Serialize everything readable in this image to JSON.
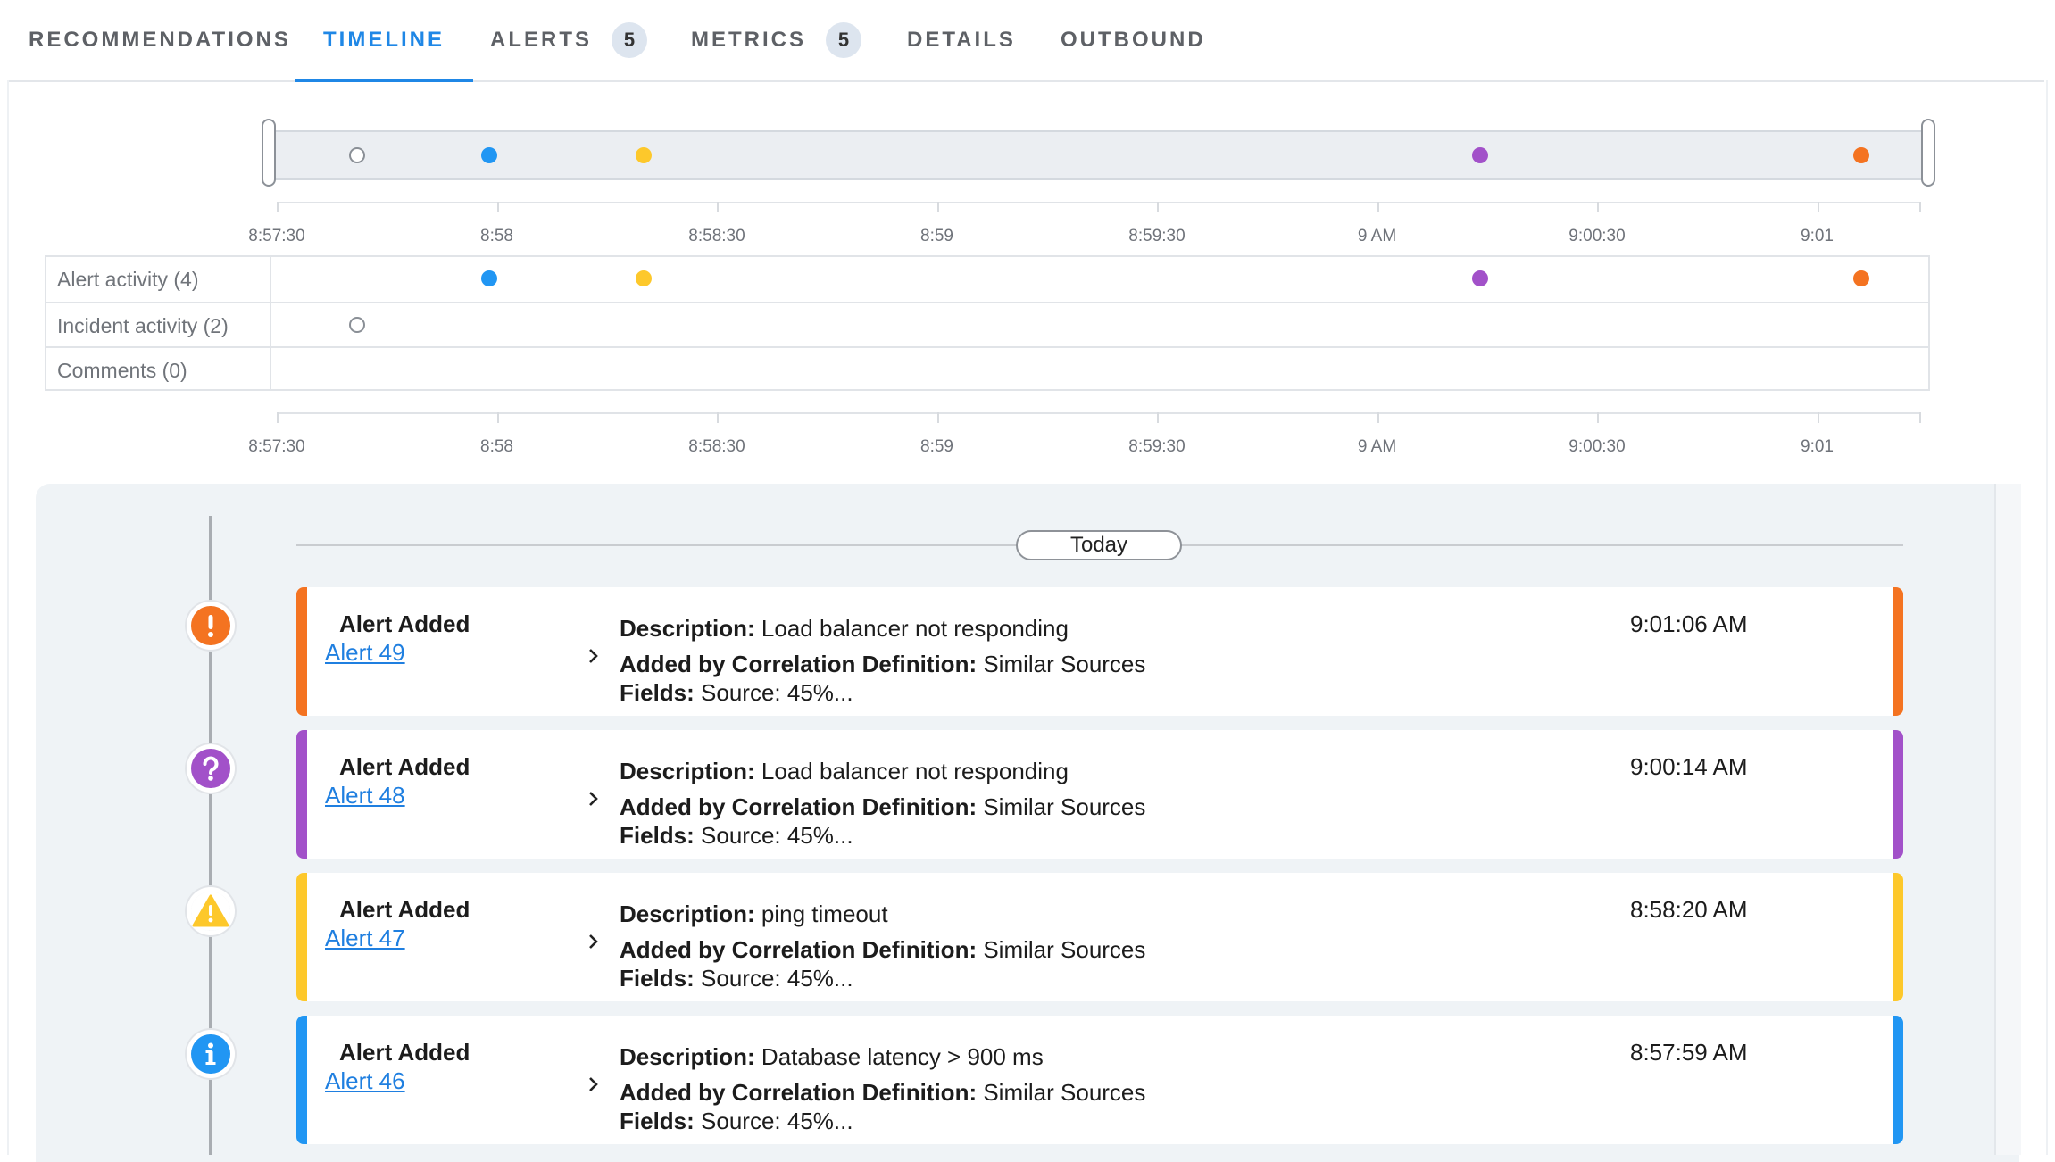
{
  "tabs": [
    {
      "label": "RECOMMENDATIONS",
      "active": false
    },
    {
      "label": "TIMELINE",
      "active": true
    },
    {
      "label": "ALERTS",
      "count": "5",
      "active": false
    },
    {
      "label": "METRICS",
      "count": "5",
      "active": false
    },
    {
      "label": "DETAILS",
      "active": false
    },
    {
      "label": "OUTBOUND",
      "active": false
    }
  ],
  "axis_ticks": [
    "8:57:30",
    "8:58",
    "8:58:30",
    "8:59",
    "8:59:30",
    "9 AM",
    "9:00:30",
    "9:01"
  ],
  "activity_rows": [
    {
      "label": "Alert activity (4)"
    },
    {
      "label": "Incident activity (2)"
    },
    {
      "label": "Comments (0)"
    }
  ],
  "colors": {
    "critical": "#f47321",
    "unknown": "#a251c9",
    "warning": "#fdc82b",
    "info": "#2196f3",
    "hollow": "#8a8f96",
    "accent": "#1f87e6"
  },
  "overview_events": [
    {
      "time": "8:57:41",
      "kind": "incident",
      "color": "hollow"
    },
    {
      "time": "8:57:59",
      "kind": "alert",
      "color": "info"
    },
    {
      "time": "8:58:20",
      "kind": "alert",
      "color": "warning"
    },
    {
      "time": "9:00:14",
      "kind": "alert",
      "color": "unknown"
    },
    {
      "time": "9:01:06",
      "kind": "alert",
      "color": "critical"
    }
  ],
  "day_label": "Today",
  "events": [
    {
      "title": "Alert Added",
      "link": "Alert 49",
      "description_label": "Description:",
      "description": "Load balancer not responding",
      "corr_label": "Added by Correlation Definition:",
      "corr": "Similar Sources",
      "fields_label": "Fields:",
      "fields": "Source: 45%...",
      "time": "9:01:06 AM",
      "severity": "critical",
      "severity_icon": "exclamation-icon"
    },
    {
      "title": "Alert Added",
      "link": "Alert 48",
      "description_label": "Description:",
      "description": "Load balancer not responding",
      "corr_label": "Added by Correlation Definition:",
      "corr": "Similar Sources",
      "fields_label": "Fields:",
      "fields": "Source: 45%...",
      "time": "9:00:14 AM",
      "severity": "unknown",
      "severity_icon": "question-icon"
    },
    {
      "title": "Alert Added",
      "link": "Alert 47",
      "description_label": "Description:",
      "description": "ping timeout",
      "corr_label": "Added by Correlation Definition:",
      "corr": "Similar Sources",
      "fields_label": "Fields:",
      "fields": "Source: 45%...",
      "time": "8:58:20 AM",
      "severity": "warning",
      "severity_icon": "warning-triangle-icon"
    },
    {
      "title": "Alert Added",
      "link": "Alert 46",
      "description_label": "Description:",
      "description": "Database latency > 900 ms",
      "corr_label": "Added by Correlation Definition:",
      "corr": "Similar Sources",
      "fields_label": "Fields:",
      "fields": "Source: 45%...",
      "time": "8:57:59 AM",
      "severity": "info",
      "severity_icon": "info-icon"
    }
  ]
}
